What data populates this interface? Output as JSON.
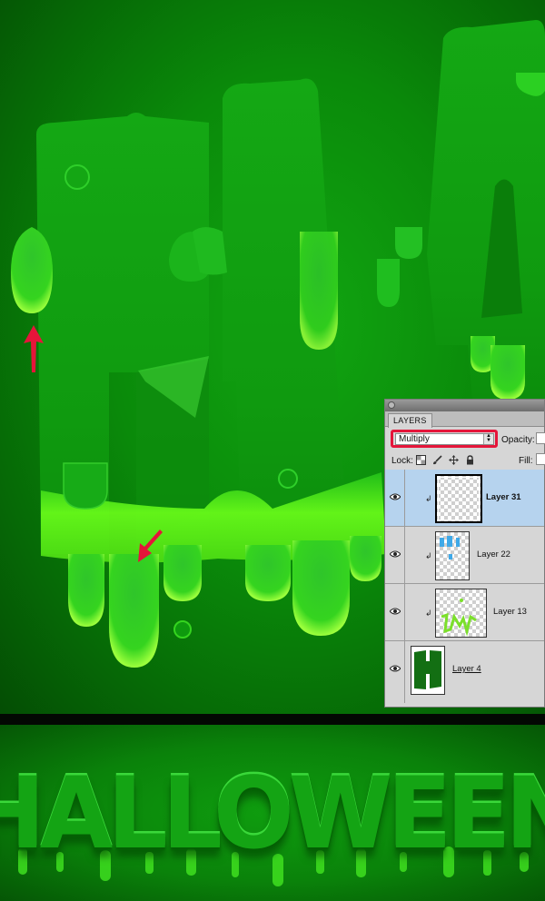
{
  "panel": {
    "tab_label": "LAYERS",
    "blend_mode": "Multiply",
    "opacity_label": "Opacity:",
    "lock_label": "Lock:",
    "fill_label": "Fill:",
    "lock_icons": [
      "transparency-lock-icon",
      "brush-lock-icon",
      "move-lock-icon",
      "padlock-icon"
    ],
    "layers": [
      {
        "name": "Layer 31",
        "selected": true,
        "clipped": true
      },
      {
        "name": "Layer 22",
        "selected": false,
        "clipped": true
      },
      {
        "name": "Layer 13",
        "selected": false,
        "clipped": true
      },
      {
        "name": "Layer 4",
        "selected": false,
        "clipped": false
      }
    ]
  },
  "banner": {
    "word": "HALLOWEEN"
  },
  "colors": {
    "slime_dark": "#0a8a0a",
    "slime_bright": "#6cff1a",
    "annotation": "#e5153a",
    "selected_row": "#b6d3ee"
  }
}
